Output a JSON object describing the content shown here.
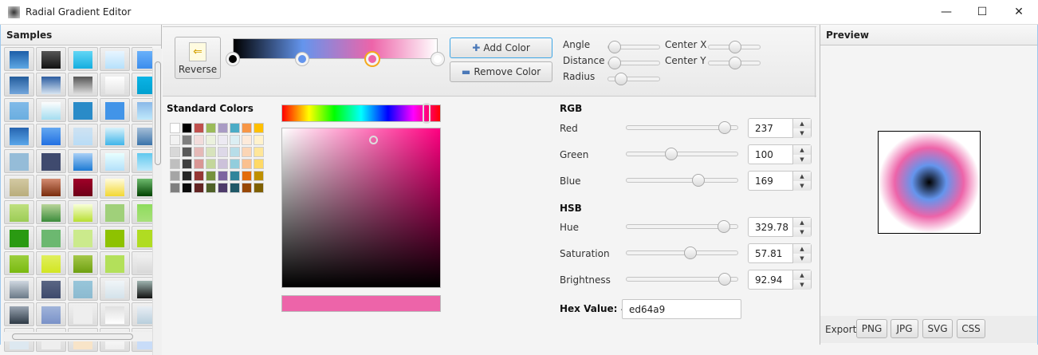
{
  "window": {
    "title": "Radial Gradient Editor",
    "minimize": "—",
    "maximize": "☐",
    "close": "✕"
  },
  "samples": {
    "title": "Samples",
    "rows": [
      [
        [
          "#1c5ea8",
          "#5fa8e4"
        ],
        [
          "#555",
          "#111"
        ],
        [
          "#62d6f5",
          "#14aee0"
        ],
        [
          "#e8f5ff",
          "#b6e1fb"
        ],
        [
          "#6ab1fa",
          "#3b8ded"
        ]
      ],
      [
        [
          "#225c9c",
          "#73a6dc"
        ],
        [
          "#2c5da0",
          "#d6e4f2"
        ],
        [
          "#555",
          "#ddd"
        ],
        [
          "#fff",
          "#e4e4e4"
        ],
        [
          "#0bb4e6",
          "#00a0d0"
        ]
      ],
      [
        [
          "#81bae8",
          "#6aaee0"
        ],
        [
          "#fdfdfd",
          "#a4ddf0"
        ],
        [
          "#2a8bc8",
          "#2a8bc8"
        ],
        [
          "#4294e8",
          "#4294e8"
        ],
        [
          "#8ab8e8",
          "#bfe8fb"
        ]
      ],
      [
        [
          "#2664b0",
          "#5aa7ea"
        ],
        [
          "#65a8f0",
          "#2170e2"
        ],
        [
          "#cfe2f2",
          "#b8dcf6"
        ],
        [
          "#d8f1fa",
          "#3fb5ea"
        ],
        [
          "#a7bfd8",
          "#3a73aa"
        ]
      ],
      [
        [
          "#95bcd8",
          "#95bcd8"
        ],
        [
          "#3f4a6e",
          "#3f4a6e"
        ],
        [
          "#a9d0f6",
          "#1c7ad4"
        ],
        [
          "#e8ffff",
          "#b3e0fa"
        ],
        [
          "#60c8ee",
          "#bde9fb"
        ]
      ],
      [
        [
          "#d3c9a3",
          "#b9ad7c"
        ],
        [
          "#d38c72",
          "#7a2c0c"
        ],
        [
          "#a00028",
          "#6e0018"
        ],
        [
          "#fffbdc",
          "#f3d832"
        ],
        [
          "#6fbc6f",
          "#004200"
        ]
      ],
      [
        [
          "#bfe07f",
          "#9ccc55"
        ],
        [
          "#b8d498",
          "#3c8c3c"
        ],
        [
          "#f8ffd8",
          "#b8df32"
        ],
        [
          "#a0d07a",
          "#a0d07a"
        ],
        [
          "#8edc5c",
          "#a8e07a"
        ]
      ],
      [
        [
          "#2a9a12",
          "#2a9a12"
        ],
        [
          "#6cb870",
          "#6cb870"
        ],
        [
          "#cbea8c",
          "#cbea8c"
        ],
        [
          "#8ec200",
          "#8ec200"
        ],
        [
          "#b0dc22",
          "#b0dc22"
        ]
      ],
      [
        [
          "#9ccf3e",
          "#7aba10"
        ],
        [
          "#e0ef5e",
          "#d2e622"
        ],
        [
          "#a5c84a",
          "#6ea010"
        ],
        [
          "#b3e05a",
          "#b3e05a"
        ],
        [
          "#f0f0f0",
          "#d8d8d8"
        ]
      ],
      [
        [
          "#cfd7e0",
          "#6b7a88"
        ],
        [
          "#5a6684",
          "#3e4a6c"
        ],
        [
          "#98c6da",
          "#8cbad0"
        ],
        [
          "#f0f5f8",
          "#d4e2ea"
        ],
        [
          "#9fb4b0",
          "#111"
        ]
      ],
      [
        [
          "#9aa5b2",
          "#2e3a46"
        ],
        [
          "#a0b4da",
          "#7a92c8"
        ],
        [
          "#eee",
          "#eee"
        ],
        [
          "#e0e0e0",
          "#fff"
        ],
        [
          "#e8eef4",
          "#b8cedc"
        ]
      ],
      [
        [
          "#dde8f0",
          "#dde8f0"
        ],
        [
          "#eee",
          "#eee"
        ],
        [
          "#f8e4c8",
          "#f8e4c8"
        ],
        [
          "#fff",
          "#eee"
        ],
        [
          "#c8dcf8",
          "#c8dcf8"
        ]
      ]
    ]
  },
  "toolbar": {
    "reverse_label": "Reverse",
    "add_color_label": "Add Color",
    "remove_color_label": "Remove Color",
    "stops": [
      {
        "offset": 0,
        "color": "#000000"
      },
      {
        "offset": 0.34,
        "color": "#6495ed"
      },
      {
        "offset": 0.68,
        "color": "#ed64a9",
        "selected": true
      },
      {
        "offset": 1,
        "color": "#ffffff"
      }
    ],
    "sliders": [
      {
        "label": "Angle",
        "value": 0
      },
      {
        "label": "Distance",
        "value": 0
      },
      {
        "label": "Radius",
        "value": 0.15
      },
      {
        "label": "Center X",
        "value": 0.5
      },
      {
        "label": "Center Y",
        "value": 0.5
      }
    ]
  },
  "standard_colors": {
    "title": "Standard Colors",
    "rows": [
      [
        "#ffffff",
        "#000000",
        "#c0504d",
        "#9bbb59",
        "#a99bc4",
        "#4bacc6",
        "#f79646",
        "#ffc000"
      ],
      [
        "#f2f2f2",
        "#7f7f7f",
        "#f2dcdb",
        "#ebf1dd",
        "#ece9f2",
        "#dbeef3",
        "#fdeada",
        "#fff2cc"
      ],
      [
        "#d8d8d8",
        "#595959",
        "#e5b9b7",
        "#d7e3bc",
        "#ddd8e8",
        "#b7dde8",
        "#fbd5b5",
        "#ffe699"
      ],
      [
        "#bfbfbf",
        "#3f3f3f",
        "#d99694",
        "#c3d69b",
        "#ccc1da",
        "#92cddc",
        "#fac08f",
        "#ffd966"
      ],
      [
        "#a5a5a5",
        "#262626",
        "#953734",
        "#76923c",
        "#7c64a0",
        "#31859b",
        "#e36c09",
        "#bf9000"
      ],
      [
        "#7f7f7f",
        "#0c0c0c",
        "#632423",
        "#4f6128",
        "#4e3b6a",
        "#205867",
        "#974806",
        "#7f6000"
      ]
    ]
  },
  "picker": {
    "hue": 329.78,
    "saturation": 57.81,
    "brightness": 92.94,
    "color": "#ed64a9"
  },
  "rgb": {
    "title": "RGB",
    "fields": [
      {
        "label": "Red",
        "value": "237",
        "fraction": 0.93
      },
      {
        "label": "Green",
        "value": "100",
        "fraction": 0.39
      },
      {
        "label": "Blue",
        "value": "169",
        "fraction": 0.66
      }
    ]
  },
  "hsb": {
    "title": "HSB",
    "fields": [
      {
        "label": "Hue",
        "value": "329.78",
        "fraction": 0.916
      },
      {
        "label": "Saturation",
        "value": "57.81",
        "fraction": 0.578
      },
      {
        "label": "Brightness",
        "value": "92.94",
        "fraction": 0.929
      }
    ]
  },
  "hex": {
    "label": "Hex Value: #",
    "value": "ed64a9"
  },
  "preview": {
    "title": "Preview",
    "export_label": "Export",
    "buttons": [
      "PNG",
      "JPG",
      "SVG",
      "CSS"
    ]
  }
}
